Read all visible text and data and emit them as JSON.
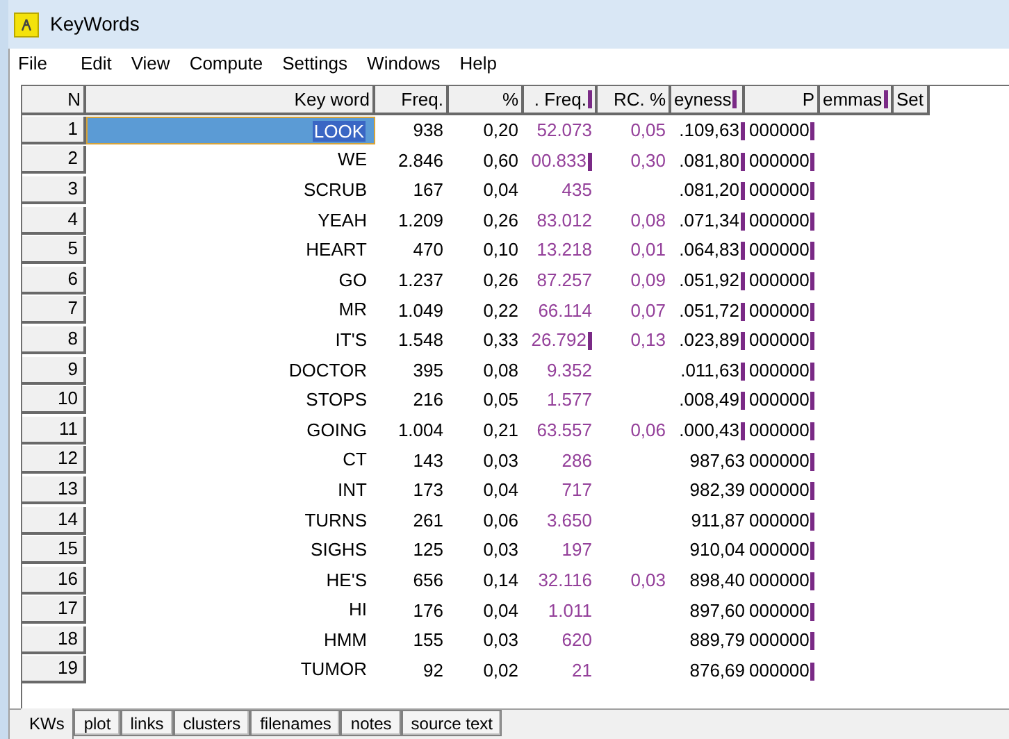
{
  "window": {
    "title": "KeyWords"
  },
  "menu": [
    "File",
    "Edit",
    "View",
    "Compute",
    "Settings",
    "Windows",
    "Help"
  ],
  "table": {
    "columns": [
      {
        "label": "N",
        "clipped": false
      },
      {
        "label": "Key word",
        "clipped": false
      },
      {
        "label": "Freq.",
        "clipped": false
      },
      {
        "label": "%",
        "clipped": false
      },
      {
        "label": ". Freq.",
        "clipped": true
      },
      {
        "label": "RC. %",
        "clipped": false
      },
      {
        "label": "eyness",
        "clipped": true
      },
      {
        "label": "P",
        "clipped": false
      },
      {
        "label": "emmas",
        "clipped": true
      },
      {
        "label": "Set",
        "clipped": false
      }
    ],
    "p_cells_clipped": true,
    "rows": [
      {
        "n": "1",
        "word": "LOOK",
        "freq": "938",
        "pct": "0,20",
        "rc_freq": "52.073",
        "rc_freq_clipped": false,
        "rc_pct": "0,05",
        "keyness": ".109,63",
        "keyness_clipped": true,
        "p": "000000",
        "selected": true
      },
      {
        "n": "2",
        "word": "WE",
        "freq": "2.846",
        "pct": "0,60",
        "rc_freq": "00.833",
        "rc_freq_clipped": true,
        "rc_pct": "0,30",
        "keyness": ".081,80",
        "keyness_clipped": true,
        "p": "000000",
        "selected": false
      },
      {
        "n": "3",
        "word": "SCRUB",
        "freq": "167",
        "pct": "0,04",
        "rc_freq": "435",
        "rc_freq_clipped": false,
        "rc_pct": "",
        "keyness": ".081,20",
        "keyness_clipped": true,
        "p": "000000",
        "selected": false
      },
      {
        "n": "4",
        "word": "YEAH",
        "freq": "1.209",
        "pct": "0,26",
        "rc_freq": "83.012",
        "rc_freq_clipped": false,
        "rc_pct": "0,08",
        "keyness": ".071,34",
        "keyness_clipped": true,
        "p": "000000",
        "selected": false
      },
      {
        "n": "5",
        "word": "HEART",
        "freq": "470",
        "pct": "0,10",
        "rc_freq": "13.218",
        "rc_freq_clipped": false,
        "rc_pct": "0,01",
        "keyness": ".064,83",
        "keyness_clipped": true,
        "p": "000000",
        "selected": false
      },
      {
        "n": "6",
        "word": "GO",
        "freq": "1.237",
        "pct": "0,26",
        "rc_freq": "87.257",
        "rc_freq_clipped": false,
        "rc_pct": "0,09",
        "keyness": ".051,92",
        "keyness_clipped": true,
        "p": "000000",
        "selected": false
      },
      {
        "n": "7",
        "word": "MR",
        "freq": "1.049",
        "pct": "0,22",
        "rc_freq": "66.114",
        "rc_freq_clipped": false,
        "rc_pct": "0,07",
        "keyness": ".051,72",
        "keyness_clipped": true,
        "p": "000000",
        "selected": false
      },
      {
        "n": "8",
        "word": "IT'S",
        "freq": "1.548",
        "pct": "0,33",
        "rc_freq": "26.792",
        "rc_freq_clipped": true,
        "rc_pct": "0,13",
        "keyness": ".023,89",
        "keyness_clipped": true,
        "p": "000000",
        "selected": false
      },
      {
        "n": "9",
        "word": "DOCTOR",
        "freq": "395",
        "pct": "0,08",
        "rc_freq": "9.352",
        "rc_freq_clipped": false,
        "rc_pct": "",
        "keyness": ".011,63",
        "keyness_clipped": true,
        "p": "000000",
        "selected": false
      },
      {
        "n": "10",
        "word": "STOPS",
        "freq": "216",
        "pct": "0,05",
        "rc_freq": "1.577",
        "rc_freq_clipped": false,
        "rc_pct": "",
        "keyness": ".008,49",
        "keyness_clipped": true,
        "p": "000000",
        "selected": false
      },
      {
        "n": "11",
        "word": "GOING",
        "freq": "1.004",
        "pct": "0,21",
        "rc_freq": "63.557",
        "rc_freq_clipped": false,
        "rc_pct": "0,06",
        "keyness": ".000,43",
        "keyness_clipped": true,
        "p": "000000",
        "selected": false
      },
      {
        "n": "12",
        "word": "CT",
        "freq": "143",
        "pct": "0,03",
        "rc_freq": "286",
        "rc_freq_clipped": false,
        "rc_pct": "",
        "keyness": "987,63",
        "keyness_clipped": false,
        "p": "000000",
        "selected": false
      },
      {
        "n": "13",
        "word": "INT",
        "freq": "173",
        "pct": "0,04",
        "rc_freq": "717",
        "rc_freq_clipped": false,
        "rc_pct": "",
        "keyness": "982,39",
        "keyness_clipped": false,
        "p": "000000",
        "selected": false
      },
      {
        "n": "14",
        "word": "TURNS",
        "freq": "261",
        "pct": "0,06",
        "rc_freq": "3.650",
        "rc_freq_clipped": false,
        "rc_pct": "",
        "keyness": "911,87",
        "keyness_clipped": false,
        "p": "000000",
        "selected": false
      },
      {
        "n": "15",
        "word": "SIGHS",
        "freq": "125",
        "pct": "0,03",
        "rc_freq": "197",
        "rc_freq_clipped": false,
        "rc_pct": "",
        "keyness": "910,04",
        "keyness_clipped": false,
        "p": "000000",
        "selected": false
      },
      {
        "n": "16",
        "word": "HE'S",
        "freq": "656",
        "pct": "0,14",
        "rc_freq": "32.116",
        "rc_freq_clipped": false,
        "rc_pct": "0,03",
        "keyness": "898,40",
        "keyness_clipped": false,
        "p": "000000",
        "selected": false
      },
      {
        "n": "17",
        "word": "HI",
        "freq": "176",
        "pct": "0,04",
        "rc_freq": "1.011",
        "rc_freq_clipped": false,
        "rc_pct": "",
        "keyness": "897,60",
        "keyness_clipped": false,
        "p": "000000",
        "selected": false
      },
      {
        "n": "18",
        "word": "HMM",
        "freq": "155",
        "pct": "0,03",
        "rc_freq": "620",
        "rc_freq_clipped": false,
        "rc_pct": "",
        "keyness": "889,79",
        "keyness_clipped": false,
        "p": "000000",
        "selected": false
      },
      {
        "n": "19",
        "word": "TUMOR",
        "freq": "92",
        "pct": "0,02",
        "rc_freq": "21",
        "rc_freq_clipped": false,
        "rc_pct": "",
        "keyness": "876,69",
        "keyness_clipped": false,
        "p": "000000",
        "selected": false
      }
    ]
  },
  "tabs": [
    {
      "label": "KWs",
      "selected": true
    },
    {
      "label": "plot",
      "selected": false
    },
    {
      "label": "links",
      "selected": false
    },
    {
      "label": "clusters",
      "selected": false
    },
    {
      "label": "filenames",
      "selected": false
    },
    {
      "label": "notes",
      "selected": false
    },
    {
      "label": "source text",
      "selected": false
    }
  ]
}
